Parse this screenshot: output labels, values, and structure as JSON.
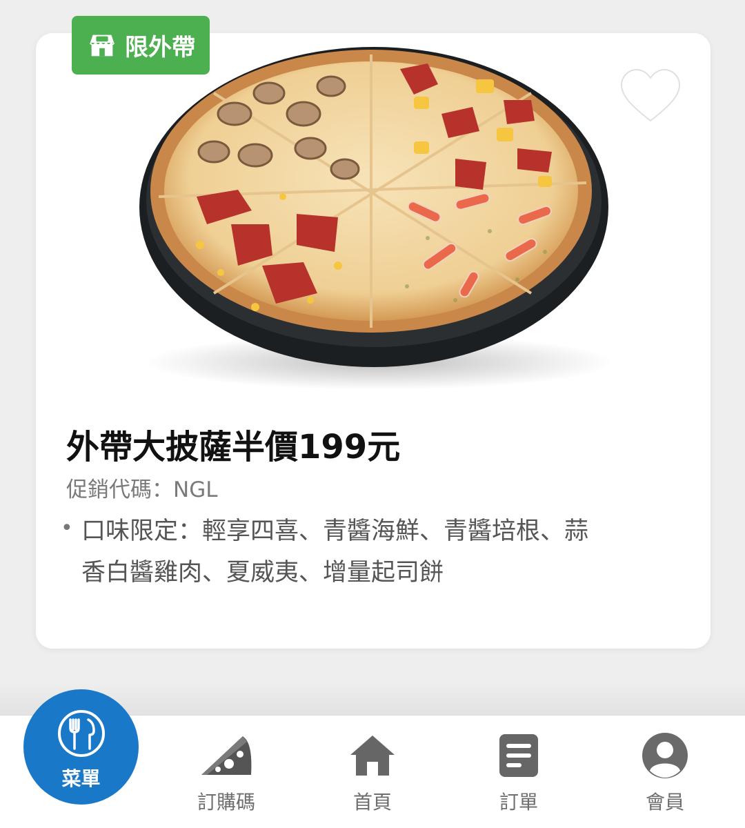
{
  "badge": {
    "label": "限外帶",
    "icon": "store-icon",
    "color": "#4caf50"
  },
  "favorite": {
    "icon": "heart-outline-icon"
  },
  "product": {
    "title": "外帶大披薩半價199元",
    "promo": "促銷代碼：NGL",
    "flavors_line1": "口味限定：輕享四喜、青醬海鮮、青醬培根、蒜",
    "flavors_line2": "香白醬雞肉、夏威夷、增量起司餅"
  },
  "nav": {
    "menu": {
      "label": "菜單",
      "icon": "utensils-icon",
      "active": true,
      "color": "#1a78c9"
    },
    "items": [
      {
        "label": "訂購碼",
        "icon": "pizza-slice-icon"
      },
      {
        "label": "首頁",
        "icon": "home-icon"
      },
      {
        "label": "訂單",
        "icon": "document-icon"
      },
      {
        "label": "會員",
        "icon": "user-icon"
      }
    ]
  }
}
